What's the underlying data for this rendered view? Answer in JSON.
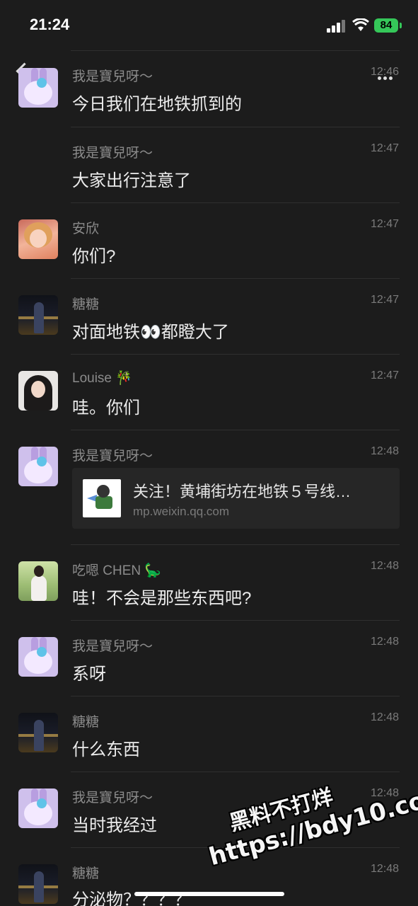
{
  "status_bar": {
    "time": "21:24",
    "battery": "84"
  },
  "messages": [
    {
      "sender": "我是寶兒呀～",
      "time": "12:46",
      "text": "今日我们在地铁抓到的",
      "avatar": "bunny-avatar"
    },
    {
      "sender": "我是寶兒呀～",
      "time": "12:47",
      "text": "大家出行注意了",
      "avatar": ""
    },
    {
      "sender": "安欣",
      "time": "12:47",
      "text": "你们?",
      "avatar": "girl-avatar"
    },
    {
      "sender": "糖糖",
      "time": "12:47",
      "text": "对面地铁👀都瞪大了",
      "avatar": "night-avatar"
    },
    {
      "sender": "Louise 🎋",
      "time": "12:47",
      "text": "哇。你们",
      "avatar": "louise-avatar"
    },
    {
      "sender": "我是寶兒呀～",
      "time": "12:48",
      "avatar": "bunny-avatar",
      "link": {
        "title": "关注！黄埔街坊在地铁５号线…",
        "url": "mp.weixin.qq.com"
      }
    },
    {
      "sender": "吃嗯 CHEN 🦕",
      "time": "12:48",
      "text": "哇！不会是那些东西吧?",
      "avatar": "chen-avatar"
    },
    {
      "sender": "我是寶兒呀～",
      "time": "12:48",
      "text": "系呀",
      "avatar": "bunny-avatar"
    },
    {
      "sender": "糖糖",
      "time": "12:48",
      "text": "什么东西",
      "avatar": "night-avatar"
    },
    {
      "sender": "我是寶兒呀～",
      "time": "12:48",
      "text": "当时我经过",
      "avatar": "bunny-avatar"
    },
    {
      "sender": "糖糖",
      "time": "12:48",
      "text": "分泌物？？？？",
      "avatar": "night-avatar"
    }
  ],
  "watermark": {
    "line1": "黑料不打烊",
    "line2": "https://bdy10.co"
  }
}
